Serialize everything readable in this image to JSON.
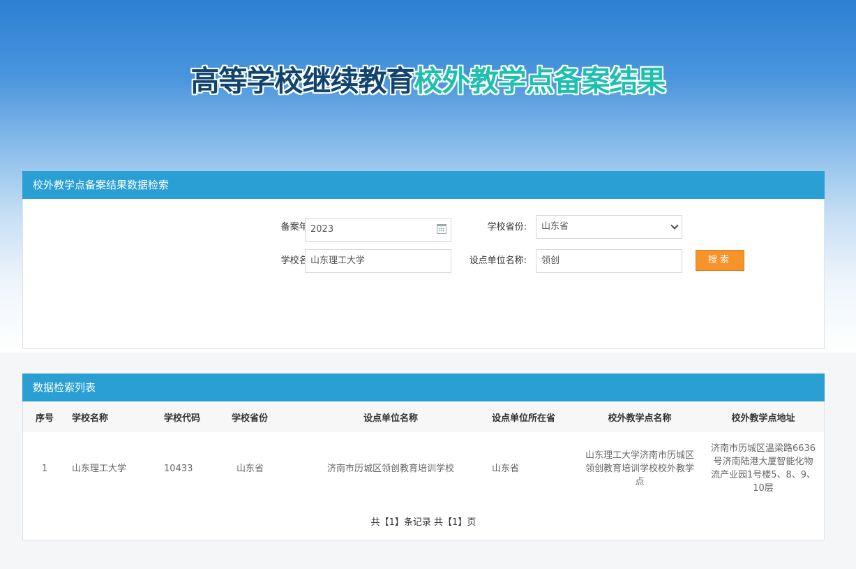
{
  "header": {
    "title_part1": "高等学校继续教育",
    "title_part2": "校外教学点备案结果"
  },
  "search_panel": {
    "title": "校外教学点备案结果数据检索",
    "year_label": "备案年份:",
    "year_value": "2023",
    "province_label": "学校省份:",
    "province_value": "山东省",
    "school_label": "学校名称:",
    "school_value": "山东理工大学",
    "unit_label": "设点单位名称:",
    "unit_value": "领创",
    "search_button": "搜索"
  },
  "list_panel": {
    "title": "数据检索列表",
    "columns": [
      "序号",
      "学校名称",
      "学校代码",
      "学校省份",
      "设点单位名称",
      "设点单位所在省",
      "校外教学点名称",
      "校外教学点地址"
    ],
    "rows": [
      [
        "1",
        "山东理工大学",
        "10433",
        "山东省",
        "济南市历城区领创教育培训学校",
        "山东省",
        "山东理工大学济南市历城区领创教育培训学校校外教学点",
        "济南市历城区温梁路6636号济南陆港大厦智能化物流产业园1号楼5、8、9、10层"
      ]
    ],
    "pager": "共【1】条记录 共【1】页"
  },
  "colors": {
    "panel_header": "#2a9fd4",
    "search_button": "#f7932b",
    "title_dark": "#11446e",
    "title_teal": "#1fbfb0"
  }
}
